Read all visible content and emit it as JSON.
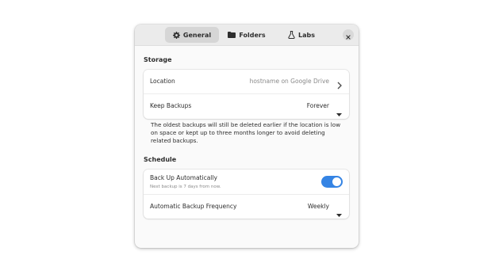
{
  "tabs": [
    {
      "label": "General",
      "icon": "gear-icon",
      "active": true
    },
    {
      "label": "Folders",
      "icon": "folder-icon",
      "active": false
    },
    {
      "label": "Labs",
      "icon": "flask-icon",
      "active": false
    }
  ],
  "storage": {
    "title": "Storage",
    "location_label": "Location",
    "location_value": "hostname on Google Drive",
    "keep_label": "Keep Backups",
    "keep_value": "Forever",
    "description": "The oldest backups will still be deleted earlier if the location is low on space or kept up to three months longer to avoid deleting related backups."
  },
  "schedule": {
    "title": "Schedule",
    "auto_label": "Back Up Automatically",
    "auto_subtitle": "Next backup is 7 days from now.",
    "auto_enabled": true,
    "freq_label": "Automatic Backup Frequency",
    "freq_value": "Weekly"
  },
  "colors": {
    "accent": "#3584e4",
    "window_bg": "#fafafa",
    "header_bg": "#ebebeb"
  }
}
